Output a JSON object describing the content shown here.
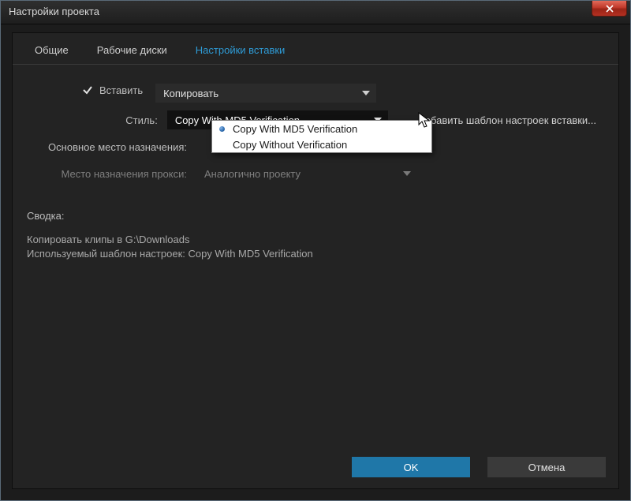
{
  "window": {
    "title": "Настройки проекта"
  },
  "tabs": {
    "general": "Общие",
    "scratch": "Рабочие диски",
    "ingest": "Настройки вставки"
  },
  "ingest": {
    "checkbox_label": "Вставить",
    "mode_value": "Копировать",
    "style_label": "Стиль:",
    "style_value": "Copy With MD5 Verification",
    "style_options": {
      "opt1": "Copy With MD5 Verification",
      "opt2": "Copy Without Verification"
    },
    "add_preset_link": "Добавить шаблон настроек вставки...",
    "primary_dest_label": "Основное место назначения:",
    "proxy_dest_label": "Место назначения прокси:",
    "proxy_dest_value": "Аналогично проекту"
  },
  "summary": {
    "title": "Сводка:",
    "line1": "Копировать клипы в G:\\Downloads",
    "line2": "Используемый шаблон настроек: Copy With MD5 Verification"
  },
  "buttons": {
    "ok": "OK",
    "cancel": "Отмена"
  }
}
